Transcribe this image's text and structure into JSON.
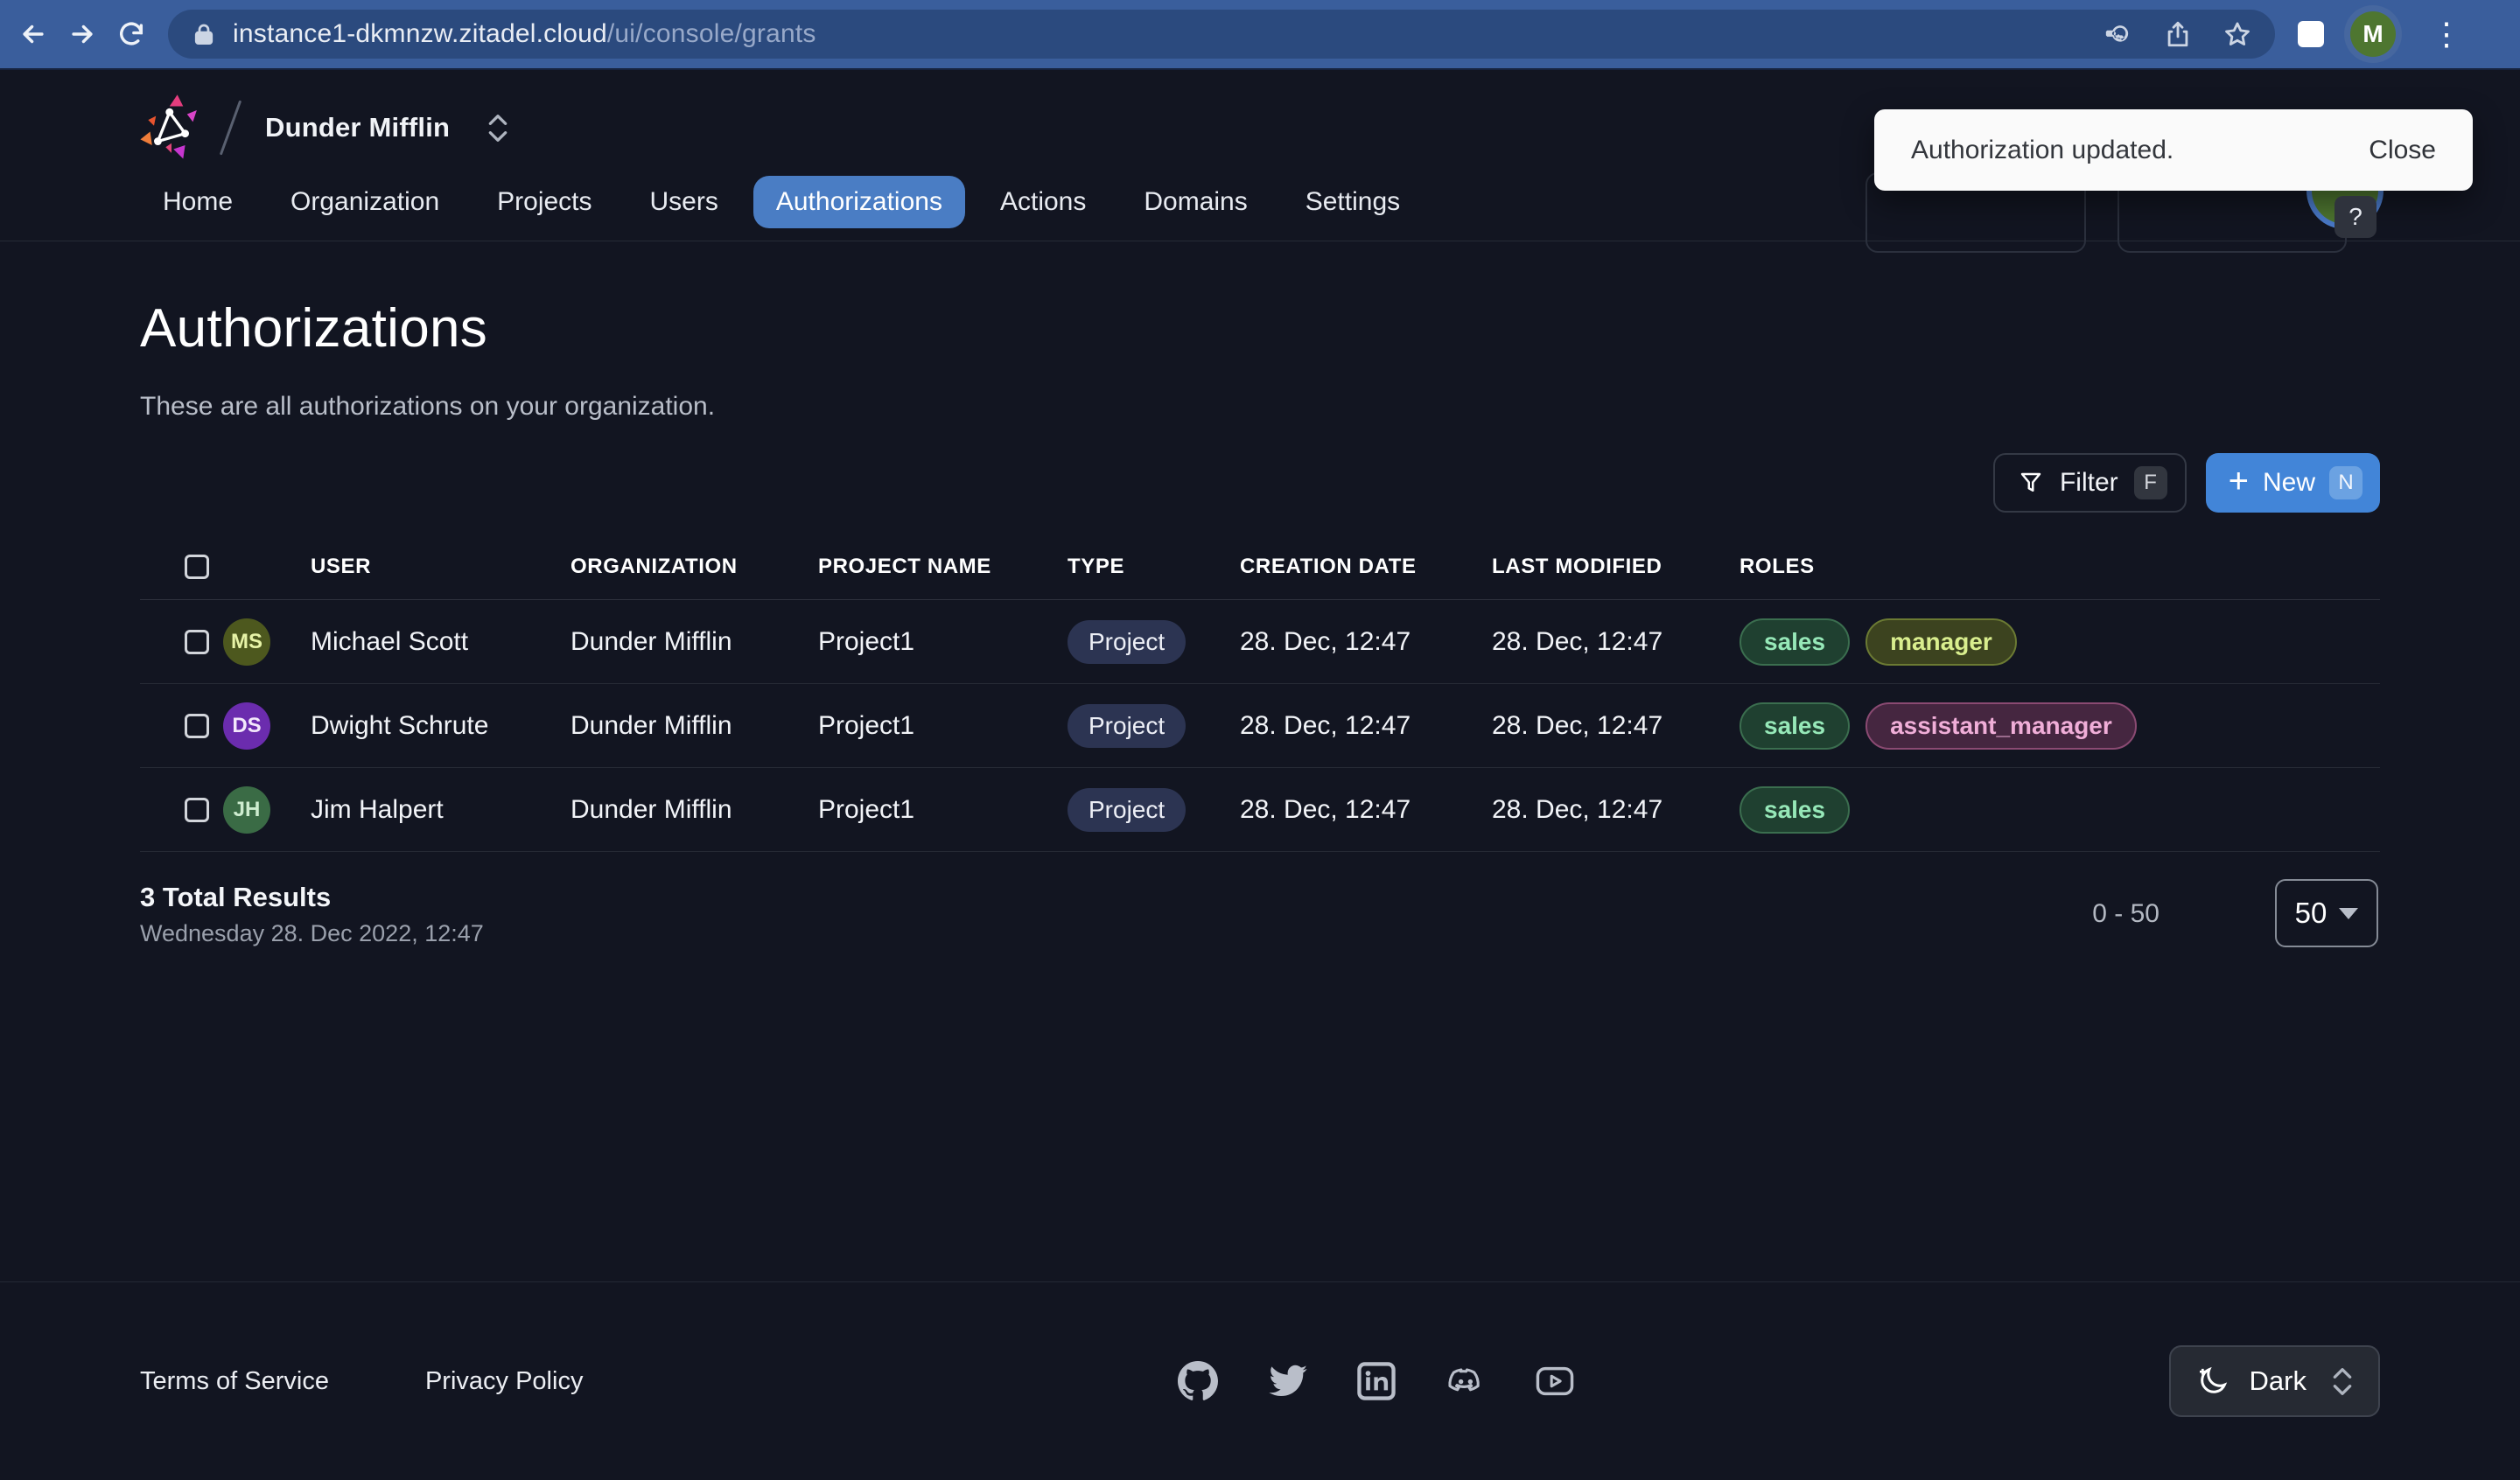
{
  "browser": {
    "url_host": "instance1-dkmnzw.zitadel.cloud",
    "url_path": "/ui/console/grants",
    "avatar_letter": "M"
  },
  "header": {
    "org_name": "Dunder Mifflin",
    "help_label": "?"
  },
  "toast": {
    "message": "Authorization updated.",
    "close_label": "Close"
  },
  "nav": {
    "active_tab": "Authorizations",
    "tabs": [
      {
        "label": "Home"
      },
      {
        "label": "Organization"
      },
      {
        "label": "Projects"
      },
      {
        "label": "Users"
      },
      {
        "label": "Authorizations"
      },
      {
        "label": "Actions"
      },
      {
        "label": "Domains"
      },
      {
        "label": "Settings"
      }
    ]
  },
  "page": {
    "title": "Authorizations",
    "subtitle": "These are all authorizations on your organization."
  },
  "toolbar": {
    "filter_label": "Filter",
    "filter_shortcut": "F",
    "new_label": "New",
    "new_shortcut": "N"
  },
  "table": {
    "columns": [
      "USER",
      "ORGANIZATION",
      "PROJECT NAME",
      "TYPE",
      "CREATION DATE",
      "LAST MODIFIED",
      "ROLES"
    ],
    "rows": [
      {
        "initials": "MS",
        "user": "Michael Scott",
        "organization": "Dunder Mifflin",
        "project": "Project1",
        "type": "Project",
        "creation_date": "28. Dec, 12:47",
        "last_modified": "28. Dec, 12:47",
        "roles": [
          {
            "label": "sales",
            "color": "#96e8b8"
          },
          {
            "label": "manager",
            "color": "#d9ee8e"
          }
        ]
      },
      {
        "initials": "DS",
        "user": "Dwight Schrute",
        "organization": "Dunder Mifflin",
        "project": "Project1",
        "type": "Project",
        "creation_date": "28. Dec, 12:47",
        "last_modified": "28. Dec, 12:47",
        "roles": [
          {
            "label": "sales",
            "color": "#96e8b8"
          },
          {
            "label": "assistant_manager",
            "color": "#f0aed8"
          }
        ]
      },
      {
        "initials": "JH",
        "user": "Jim Halpert",
        "organization": "Dunder Mifflin",
        "project": "Project1",
        "type": "Project",
        "creation_date": "28. Dec, 12:47",
        "last_modified": "28. Dec, 12:47",
        "roles": [
          {
            "label": "sales",
            "color": "#96e8b8"
          }
        ]
      }
    ]
  },
  "pagination": {
    "total_results": "3 Total Results",
    "timestamp": "Wednesday 28. Dec 2022, 12:47",
    "range": "0 - 50",
    "page_size": "50"
  },
  "footer": {
    "terms_label": "Terms of Service",
    "privacy_label": "Privacy Policy",
    "social_icons": [
      "github",
      "twitter",
      "linkedin",
      "discord",
      "youtube"
    ],
    "theme_label": "Dark"
  },
  "colors": {
    "accent_blue": "#4285d8",
    "active_tab": "#4a7dc4",
    "page_bg": "#121521",
    "browser_bar": "#3a5e9c",
    "toast_bg": "#fafafa"
  }
}
